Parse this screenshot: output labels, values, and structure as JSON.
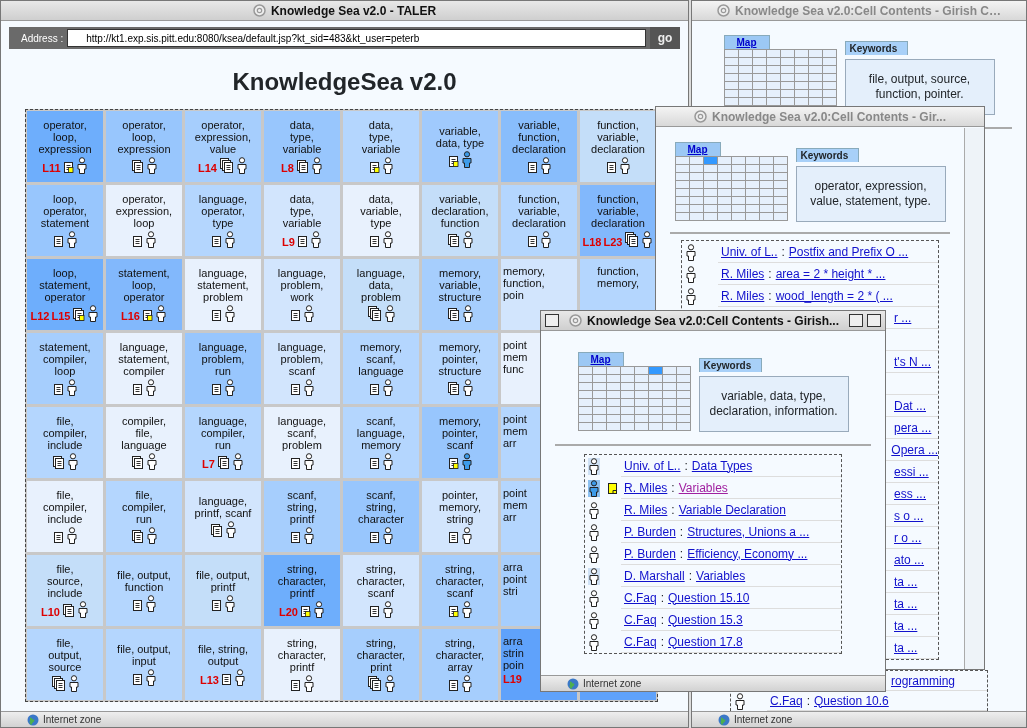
{
  "main_window": {
    "title": "Knowledge Sea v2.0 - TALER",
    "address_label": "Address :",
    "address": "http://kt1.exp.sis.pitt.edu:8080/ksea/default.jsp?kt_sid=483&kt_user=peterb",
    "go_button": "go",
    "heading": "KnowledgeSea v2.0",
    "grid": {
      "rows": [
        [
          {
            "kind": "note",
            "active": false,
            "lines": [
              "operator,",
              "loop,",
              "expression"
            ],
            "lectures": [
              "L11"
            ],
            "color": "#6eaefc"
          },
          {
            "kind": "multi",
            "active": false,
            "lines": [
              "operator,",
              "loop,",
              "expression"
            ],
            "color": "#98c6fd"
          },
          {
            "kind": "stack",
            "active": false,
            "lines": [
              "operator,",
              "expression,",
              "value"
            ],
            "lectures": [
              "L14"
            ],
            "color": "#a6cefd"
          },
          {
            "kind": "multi",
            "active": false,
            "lines": [
              "data,",
              "type,",
              "variable"
            ],
            "lectures": [
              "L8"
            ],
            "color": "#98c6fd"
          },
          {
            "kind": "note",
            "active": false,
            "lines": [
              "data,",
              "type,",
              "variable"
            ],
            "color": "#b4d6fe"
          },
          {
            "kind": "note",
            "active": true,
            "lines": [
              "variable,",
              "data, type"
            ],
            "color": "#a0cafd"
          },
          {
            "kind": "single",
            "active": false,
            "lines": [
              "variable,",
              "function,",
              "declaration"
            ],
            "color": "#88bdfc"
          },
          {
            "kind": "single",
            "active": false,
            "lines": [
              "function,",
              "variable,",
              "declaration"
            ],
            "color": "#c4def9"
          }
        ],
        [
          {
            "kind": "single",
            "active": false,
            "lines": [
              "loop,",
              "operator,",
              "statement"
            ],
            "color": "#98c6fd"
          },
          {
            "kind": "single",
            "active": false,
            "lines": [
              "operator,",
              "expression,",
              "loop"
            ],
            "color": "#e8f1fd"
          },
          {
            "kind": "single",
            "active": false,
            "lines": [
              "language,",
              "operator,",
              "type"
            ],
            "color": "#b4d6fe"
          },
          {
            "kind": "single",
            "active": false,
            "lines": [
              "data,",
              "type,",
              "variable"
            ],
            "lectures": [
              "L9"
            ],
            "color": "#d2e5fd"
          },
          {
            "kind": "single",
            "active": false,
            "lines": [
              "data,",
              "variable,",
              "type"
            ],
            "color": "#e8f1fd"
          },
          {
            "kind": "multi",
            "active": false,
            "lines": [
              "variable,",
              "declaration,",
              "function"
            ],
            "color": "#c4def9"
          },
          {
            "kind": "single",
            "active": false,
            "lines": [
              "function,",
              "variable,",
              "declaration"
            ],
            "color": "#b4d6fe"
          },
          {
            "kind": "stack",
            "active": false,
            "lines": [
              "function,",
              "variable,",
              "declaration"
            ],
            "lectures": [
              "L18",
              "L23"
            ],
            "color": "#82b8fc"
          }
        ],
        [
          {
            "kind": "note-stack",
            "active": false,
            "lines": [
              "loop,",
              "statement,",
              "operator"
            ],
            "lectures": [
              "L12",
              "L15"
            ],
            "color": "#6eaefc"
          },
          {
            "kind": "note",
            "active": false,
            "lines": [
              "statement,",
              "loop,",
              "operator"
            ],
            "lectures": [
              "L16"
            ],
            "color": "#82b8fc"
          },
          {
            "kind": "single",
            "active": false,
            "lines": [
              "language,",
              "statement,",
              "problem"
            ],
            "color": "#e8f1fd"
          },
          {
            "kind": "single",
            "active": false,
            "lines": [
              "language,",
              "problem,",
              "work"
            ],
            "color": "#d2e5fd"
          },
          {
            "kind": "stack",
            "active": false,
            "lines": [
              "language,",
              "data,",
              "problem"
            ],
            "color": "#c4def9"
          },
          {
            "kind": "multi",
            "active": false,
            "lines": [
              "memory,",
              "variable,",
              "structure"
            ],
            "color": "#a6cefd"
          },
          {
            "kind": "covered",
            "lines": [
              "memory,",
              "function,",
              "poin"
            ],
            "color": "#d2e5fd"
          },
          {
            "kind": "covered",
            "lines": [
              "function,",
              "memory,"
            ],
            "color": "#b4d6fe"
          }
        ],
        [
          {
            "kind": "single",
            "active": false,
            "lines": [
              "statement,",
              "compiler,",
              "loop"
            ],
            "color": "#a6cefd"
          },
          {
            "kind": "single",
            "active": false,
            "lines": [
              "language,",
              "statement,",
              "compiler"
            ],
            "color": "#e8f1fd"
          },
          {
            "kind": "single",
            "active": false,
            "lines": [
              "language,",
              "problem,",
              "run"
            ],
            "color": "#98c6fd"
          },
          {
            "kind": "single",
            "active": false,
            "lines": [
              "language,",
              "problem,",
              "scanf"
            ],
            "color": "#d2e5fd"
          },
          {
            "kind": "single",
            "active": false,
            "lines": [
              "memory,",
              "scanf,",
              "language"
            ],
            "color": "#b4d6fe"
          },
          {
            "kind": "multi",
            "active": false,
            "lines": [
              "memory,",
              "pointer,",
              "structure"
            ],
            "color": "#b4d6fe"
          },
          {
            "kind": "covered",
            "lines": [
              "point",
              "mem",
              "func"
            ],
            "color": "#e8f1fd"
          }
        ],
        [
          {
            "kind": "multi",
            "active": false,
            "lines": [
              "file,",
              "compiler,",
              "include"
            ],
            "color": "#b4d6fe"
          },
          {
            "kind": "multi",
            "active": false,
            "lines": [
              "compiler,",
              "file,",
              "language"
            ],
            "color": "#e8f1fd"
          },
          {
            "kind": "multi",
            "active": false,
            "lines": [
              "language,",
              "compiler,",
              "run"
            ],
            "lectures": [
              "L7"
            ],
            "color": "#b4d6fe"
          },
          {
            "kind": "single",
            "active": false,
            "lines": [
              "language,",
              "scanf,",
              "problem"
            ],
            "color": "#e8f1fd"
          },
          {
            "kind": "single",
            "active": false,
            "lines": [
              "scanf,",
              "language,",
              "memory"
            ],
            "color": "#b4d6fe"
          },
          {
            "kind": "note",
            "active": true,
            "lines": [
              "memory,",
              "pointer,",
              "scanf"
            ],
            "color": "#98c6fd"
          },
          {
            "kind": "covered",
            "lines": [
              "point",
              "mem",
              "arr"
            ],
            "color": "#b4d6fe"
          }
        ],
        [
          {
            "kind": "single",
            "active": false,
            "lines": [
              "file,",
              "compiler,",
              "include"
            ],
            "color": "#e8f1fd"
          },
          {
            "kind": "multi",
            "active": false,
            "lines": [
              "file,",
              "compiler,",
              "run"
            ],
            "color": "#b4d6fe"
          },
          {
            "kind": "multi",
            "active": false,
            "lines": [
              "language,",
              "printf, scanf"
            ],
            "color": "#d2e5fd"
          },
          {
            "kind": "single",
            "active": false,
            "lines": [
              "scanf,",
              "string,",
              "printf"
            ],
            "color": "#a6cefd"
          },
          {
            "kind": "single",
            "active": false,
            "lines": [
              "scanf,",
              "string,",
              "character"
            ],
            "color": "#98c6fd"
          },
          {
            "kind": "single",
            "active": false,
            "lines": [
              "pointer,",
              "memory,",
              "string"
            ],
            "color": "#d2e5fd"
          },
          {
            "kind": "covered",
            "lines": [
              "point",
              "mem",
              "arr"
            ],
            "color": "#b4d6fe"
          }
        ],
        [
          {
            "kind": "multi",
            "active": false,
            "lines": [
              "file,",
              "source,",
              "include"
            ],
            "lectures": [
              "L10"
            ],
            "color": "#c4def9"
          },
          {
            "kind": "single",
            "active": false,
            "lines": [
              "file, output,",
              "function"
            ],
            "color": "#b4d6fe"
          },
          {
            "kind": "single",
            "active": false,
            "lines": [
              "file, output,",
              "printf"
            ],
            "color": "#c4def9"
          },
          {
            "kind": "note",
            "active": false,
            "lines": [
              "string,",
              "character,",
              "printf"
            ],
            "lectures": [
              "L20"
            ],
            "color": "#6eaefc"
          },
          {
            "kind": "single",
            "active": false,
            "lines": [
              "string,",
              "character,",
              "scanf"
            ],
            "color": "#d2e5fd"
          },
          {
            "kind": "note",
            "active": false,
            "lines": [
              "string,",
              "character,",
              "scanf"
            ],
            "color": "#a6cefd"
          },
          {
            "kind": "covered",
            "lines": [
              "arra",
              "point",
              "stri"
            ],
            "color": "#a6cefd"
          }
        ],
        [
          {
            "kind": "stack",
            "active": false,
            "lines": [
              "file,",
              "output,",
              "source"
            ],
            "color": "#b4d6fe"
          },
          {
            "kind": "single",
            "active": false,
            "lines": [
              "file, output,",
              "input"
            ],
            "color": "#b4d6fe"
          },
          {
            "kind": "single",
            "active": false,
            "lines": [
              "file, string,",
              "output"
            ],
            "lectures": [
              "L13"
            ],
            "color": "#b4d6fe"
          },
          {
            "kind": "single",
            "active": false,
            "lines": [
              "string,",
              "character,",
              "printf"
            ],
            "color": "#e8f1fd"
          },
          {
            "kind": "stack",
            "active": false,
            "lines": [
              "string,",
              "character,",
              "print"
            ],
            "color": "#a6cefd"
          },
          {
            "kind": "single",
            "active": false,
            "lines": [
              "string,",
              "character,",
              "array"
            ],
            "color": "#a6cefd"
          },
          {
            "kind": "covered",
            "lines": [
              "arra",
              "strin",
              "poin"
            ],
            "lectures": [
              "L19"
            ],
            "color": "#5fa2fb"
          },
          {
            "kind": "covered",
            "color": "#5fa2fb"
          }
        ]
      ]
    },
    "status": "Internet zone"
  },
  "cell_windows": [
    {
      "title": "Knowledge Sea v2.0:Cell Contents - Girish C…",
      "active": false,
      "map": {
        "label": "Map",
        "first_row": [
          {
            "selected": false
          },
          {
            "selected": false
          },
          {
            "selected": false
          },
          {
            "selected": false
          },
          {
            "selected": false
          },
          {
            "selected": false
          },
          {
            "selected": false
          },
          {
            "selected": false
          }
        ]
      },
      "keywords_label": "Keywords",
      "keywords": "file, output, source, function, pointer.",
      "links": [
        {
          "kind": "partial",
          "fragment": "rogramming"
        },
        {
          "kind": "full",
          "highlighted": false,
          "active": false,
          "note": false,
          "author": "C.Faq",
          "separator": ":",
          "title": "Question 10.6",
          "visited": false
        }
      ],
      "status": "Internet zone"
    },
    {
      "title": "Knowledge Sea v2.0:Cell Contents - Gir...",
      "active": false,
      "map": {
        "label": "Map",
        "first_row": [
          {
            "selected": false
          },
          {
            "selected": false
          },
          {
            "selected": true
          },
          {
            "selected": false
          },
          {
            "selected": false
          },
          {
            "selected": false
          },
          {
            "selected": false
          },
          {
            "selected": false
          }
        ]
      },
      "keywords_label": "Keywords",
      "keywords": "operator, expression, value, statement, type.",
      "links": [
        {
          "kind": "full",
          "highlighted": false,
          "active": false,
          "note": false,
          "author": "Univ. of L..",
          "separator": ":",
          "title": "Postfix and Prefix O ...",
          "visited": false
        },
        {
          "kind": "full",
          "highlighted": false,
          "active": false,
          "note": false,
          "author": "R. Miles",
          "separator": ":",
          "title": "area = 2 * height * ...",
          "visited": false
        },
        {
          "kind": "full",
          "highlighted": false,
          "active": false,
          "note": false,
          "author": "R. Miles",
          "separator": ":",
          "title": "wood_length = 2 * ( ...",
          "visited": false
        },
        {
          "kind": "partial",
          "fragment": "r ..."
        },
        {
          "kind": "hidden"
        },
        {
          "kind": "partial",
          "fragment": "t's N ..."
        },
        {
          "kind": "hidden"
        },
        {
          "kind": "partial",
          "fragment": "Dat ..."
        },
        {
          "kind": "partial",
          "fragment": "pera ..."
        },
        {
          "kind": "partial",
          "fragment": "Opera ..."
        },
        {
          "kind": "partial",
          "fragment": "essi ..."
        },
        {
          "kind": "partial",
          "fragment": "ess ..."
        },
        {
          "kind": "partial",
          "fragment": "s o ..."
        },
        {
          "kind": "partial",
          "fragment": "r o ..."
        },
        {
          "kind": "partial",
          "fragment": "ato ..."
        },
        {
          "kind": "partial",
          "fragment": "ta ..."
        },
        {
          "kind": "partial",
          "fragment": "ta ..."
        },
        {
          "kind": "partial",
          "fragment": "ta ..."
        },
        {
          "kind": "partial",
          "fragment": "ta ..."
        }
      ]
    },
    {
      "title": "Knowledge Sea v2.0:Cell Contents - Girish...",
      "active": true,
      "map": {
        "label": "Map",
        "first_row": [
          {
            "selected": false
          },
          {
            "selected": false
          },
          {
            "selected": false
          },
          {
            "selected": false
          },
          {
            "selected": false
          },
          {
            "selected": true
          },
          {
            "selected": false
          },
          {
            "selected": false
          }
        ]
      },
      "keywords_label": "Keywords",
      "keywords": "variable, data, type, declaration, information.",
      "links": [
        {
          "kind": "full",
          "highlighted": true,
          "active": false,
          "note": false,
          "author": "Univ. of L..",
          "separator": ":",
          "title": "Data Types",
          "visited": false
        },
        {
          "kind": "full",
          "highlighted": true,
          "active": true,
          "note": true,
          "author": "R. Miles",
          "separator": ":",
          "title": "Variables",
          "visited": true
        },
        {
          "kind": "full",
          "highlighted": false,
          "active": false,
          "note": false,
          "author": "R. Miles",
          "separator": ":",
          "title": "Variable Declaration",
          "visited": false
        },
        {
          "kind": "full",
          "highlighted": false,
          "active": false,
          "note": false,
          "author": "P. Burden",
          "separator": ":",
          "title": "Structures, Unions a ...",
          "visited": false
        },
        {
          "kind": "full",
          "highlighted": false,
          "active": false,
          "note": false,
          "author": "P. Burden",
          "separator": ":",
          "title": "Efficiency, Economy ...",
          "visited": false
        },
        {
          "kind": "full",
          "highlighted": true,
          "active": false,
          "note": false,
          "author": "D. Marshall",
          "separator": ":",
          "title": "Variables",
          "visited": false
        },
        {
          "kind": "full",
          "highlighted": false,
          "active": false,
          "note": false,
          "author": "C.Faq",
          "separator": ":",
          "title": "Question 15.10",
          "visited": false
        },
        {
          "kind": "full",
          "highlighted": false,
          "active": false,
          "note": false,
          "author": "C.Faq",
          "separator": ":",
          "title": "Question 15.3",
          "visited": false
        },
        {
          "kind": "full",
          "highlighted": false,
          "active": false,
          "note": false,
          "author": "C.Faq",
          "separator": ":",
          "title": "Question 17.8",
          "visited": false
        }
      ],
      "status": "Internet zone"
    }
  ]
}
